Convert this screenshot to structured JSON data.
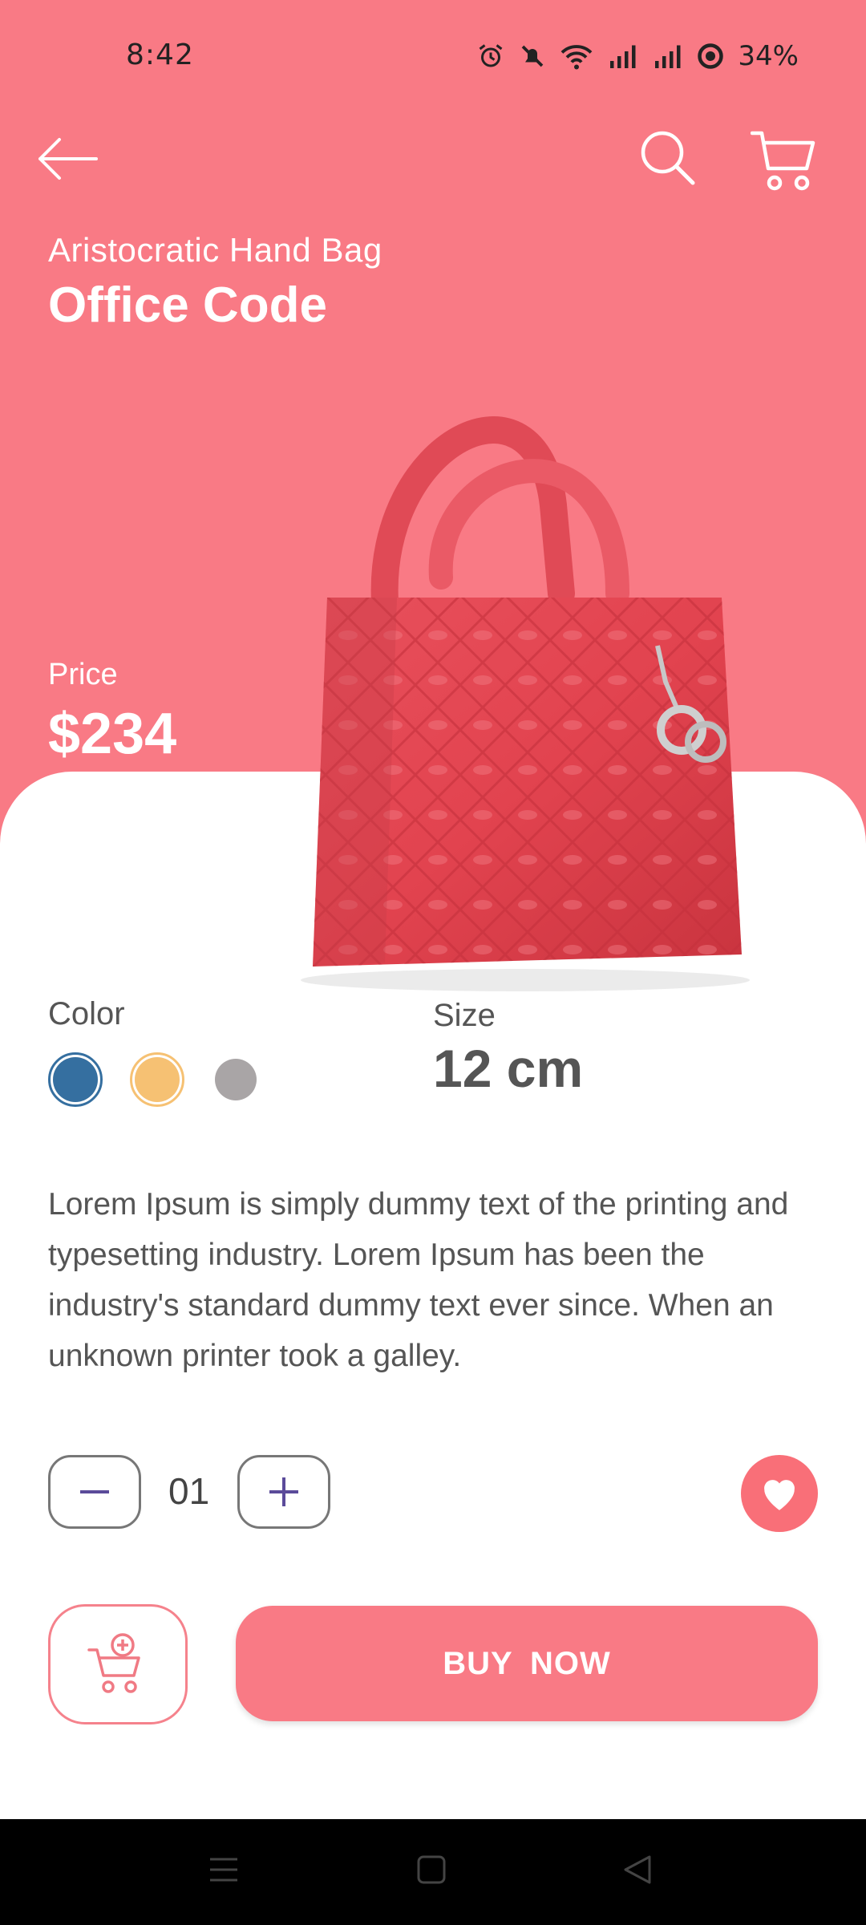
{
  "status_bar": {
    "time": "8:42",
    "battery": "34%"
  },
  "header": {
    "back_icon": "arrow-left-icon",
    "search_icon": "search-icon",
    "cart_icon": "cart-icon"
  },
  "product": {
    "subtitle": "Aristocratic Hand Bag",
    "title": "Office Code",
    "price_label": "Price",
    "price": "$234",
    "image_icon": "red-handbag-image"
  },
  "options": {
    "color_label": "Color",
    "colors": [
      "#356FA0",
      "#F6C173",
      "#A9A5A6"
    ],
    "size_label": "Size",
    "size_value": "12 cm"
  },
  "description": "Lorem Ipsum is simply dummy text of the printing and typesetting industry. Lorem Ipsum has been the industry's standard dummy text ever since. When an unknown printer took a galley.",
  "quantity": {
    "value": "01"
  },
  "actions": {
    "buy_label": "BUY  NOW"
  },
  "theme": {
    "accent": "#F97A85"
  }
}
